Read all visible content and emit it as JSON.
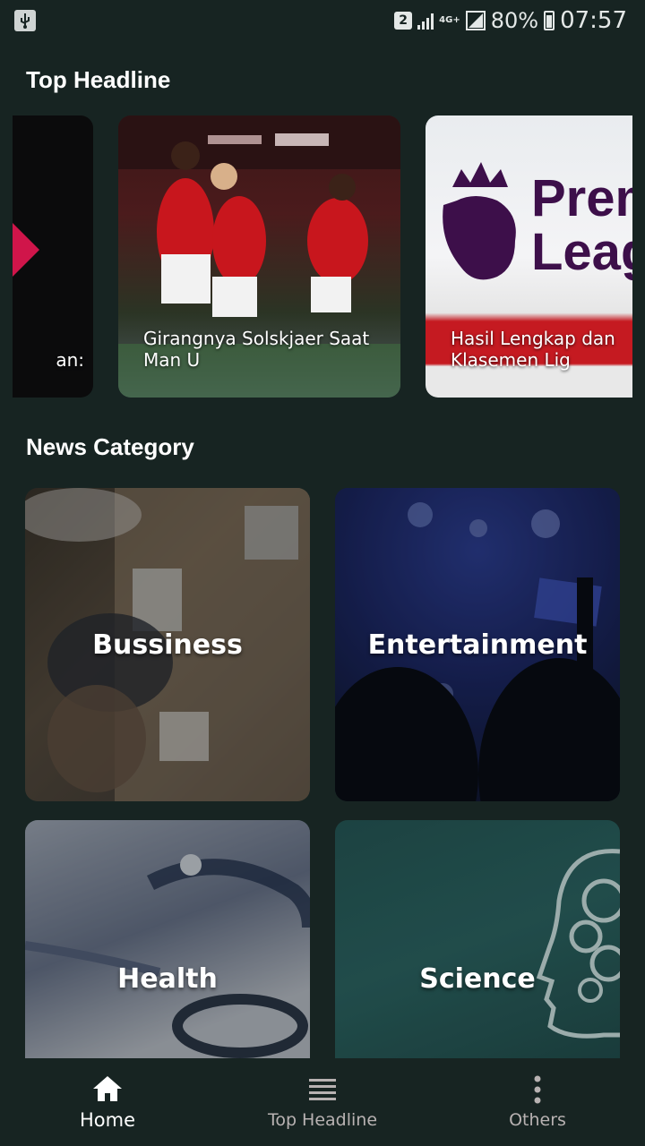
{
  "status_bar": {
    "sim_slot": "2",
    "network_type": "4G+",
    "battery_percent": "80%",
    "time": "07:57"
  },
  "top_headline": {
    "title": "Top Headline",
    "cards": [
      {
        "caption": "an:"
      },
      {
        "caption": "Girangnya Solskjaer Saat Man U"
      },
      {
        "caption": "Hasil Lengkap dan Klasemen Lig"
      }
    ]
  },
  "news_category": {
    "title": "News Category",
    "items": [
      {
        "label": "Bussiness"
      },
      {
        "label": "Entertainment"
      },
      {
        "label": "Health"
      },
      {
        "label": "Science"
      }
    ]
  },
  "card_image_text": {
    "league_line1": "Prem",
    "league_line2": "Leag"
  },
  "bottom_nav": {
    "items": [
      {
        "label": "Home",
        "icon": "home-icon",
        "active": true
      },
      {
        "label": "Top Headline",
        "icon": "list-icon",
        "active": false
      },
      {
        "label": "Others",
        "icon": "more-vertical-icon",
        "active": false
      }
    ]
  },
  "colors": {
    "background": "#172422",
    "active_nav": "#ffffff",
    "inactive_nav": "#b8b2b2"
  }
}
